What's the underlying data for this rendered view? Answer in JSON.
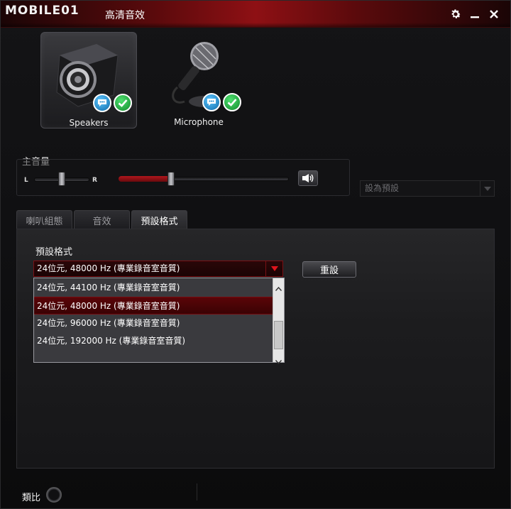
{
  "window": {
    "brand": "MOBILE01",
    "title": "高清音效"
  },
  "devices": [
    {
      "label": "Speakers",
      "selected": true,
      "icon": "speaker-icon"
    },
    {
      "label": "Microphone",
      "selected": false,
      "icon": "microphone-icon"
    }
  ],
  "volume": {
    "label": "主音量",
    "left_label": "L",
    "right_label": "R",
    "balance_level": 0.5,
    "main_level": 0.31
  },
  "default_device": {
    "label": "設為預設"
  },
  "tabs": [
    {
      "label": "喇叭組態",
      "active": false
    },
    {
      "label": "音效",
      "active": false
    },
    {
      "label": "預設格式",
      "active": true
    }
  ],
  "format": {
    "label": "預設格式",
    "selected": "24位元, 48000 Hz (專業錄音室音質)",
    "reset_label": "重設",
    "options": [
      "24位元, 44100 Hz (專業錄音室音質)",
      "24位元, 48000 Hz (專業錄音室音質)",
      "24位元, 96000 Hz (專業錄音室音質)",
      "24位元, 192000 Hz (專業錄音室音質)"
    ]
  },
  "footer": {
    "analog_label": "類比"
  },
  "colors": {
    "accent": "#8e1014",
    "selection": "#5a0508",
    "ok": "#1aa33a",
    "chat": "#1b86c8"
  }
}
